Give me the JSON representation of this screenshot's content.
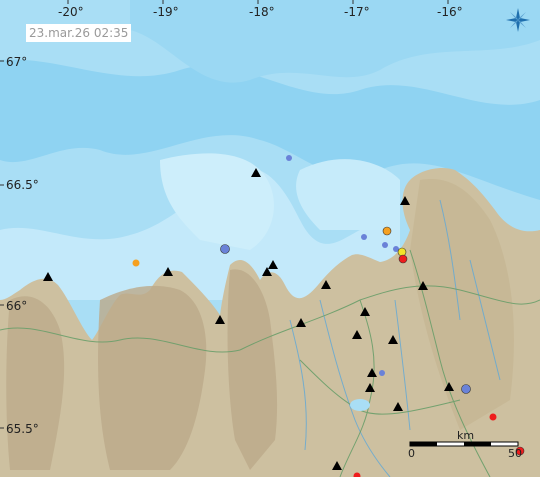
{
  "timestamp": "23.mar.26  02:35",
  "longitude_labels": [
    "-20°",
    "-19°",
    "-18°",
    "-17°",
    "-16°"
  ],
  "latitude_labels": [
    "67°",
    "66.5°",
    "66°",
    "65.5°"
  ],
  "scale_bar": {
    "unit": "km",
    "start": "0",
    "end": "50"
  },
  "compass_icon": "compass-rose-icon",
  "colors": {
    "ocean_deep": "#7fcdf0",
    "ocean_mid": "#a9def5",
    "ocean_shallow": "#c9ecfb",
    "land": "#cdc0a0",
    "land_relief": "#b8a684",
    "rivers": "#5fa8d8",
    "roads": "#6a9e6a",
    "station": "#000000",
    "quake_blue": "#6a82d8",
    "quake_orange": "#f5a020",
    "quake_yellow": "#f2e22a",
    "quake_red": "#ee1d1d"
  },
  "stations_count_visible": 19,
  "earthquakes": [
    {
      "color": "blue"
    },
    {
      "color": "blue"
    },
    {
      "color": "blue"
    },
    {
      "color": "blue"
    },
    {
      "color": "blue"
    },
    {
      "color": "blue"
    },
    {
      "color": "blue"
    },
    {
      "color": "orange"
    },
    {
      "color": "orange"
    },
    {
      "color": "yellow"
    },
    {
      "color": "red"
    },
    {
      "color": "red"
    },
    {
      "color": "red"
    },
    {
      "color": "red"
    }
  ]
}
